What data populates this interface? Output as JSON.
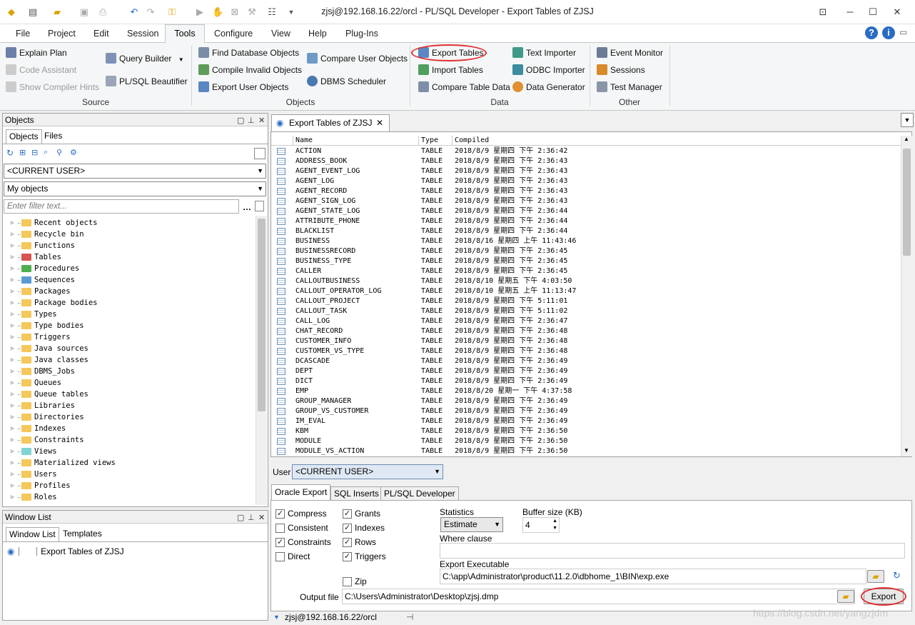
{
  "window": {
    "title": "zjsj@192.168.16.22/orcl - PL/SQL Developer - Export Tables of ZJSJ",
    "restore": "⊡",
    "minimize": "─",
    "maximize": "☐",
    "close": "✕"
  },
  "menu": [
    "File",
    "Project",
    "Edit",
    "Session",
    "Tools",
    "Configure",
    "View",
    "Help",
    "Plug-Ins"
  ],
  "ribbon": {
    "source": {
      "label": "Source",
      "explain_plan": "Explain Plan",
      "code_assistant": "Code Assistant",
      "show_compiler_hints": "Show Compiler Hints",
      "query_builder": "Query Builder",
      "beautifier": "PL/SQL Beautifier"
    },
    "objects": {
      "label": "Objects",
      "find_db_objects": "Find Database Objects",
      "compile_invalid": "Compile Invalid Objects",
      "export_user": "Export User Objects",
      "compare_user": "Compare User Objects",
      "dbms_scheduler": "DBMS Scheduler"
    },
    "data": {
      "label": "Data",
      "export_tables": "Export Tables",
      "import_tables": "Import Tables",
      "compare_table": "Compare Table Data",
      "text_importer": "Text Importer",
      "odbc_importer": "ODBC Importer",
      "data_generator": "Data Generator"
    },
    "other": {
      "label": "Other",
      "event_monitor": "Event Monitor",
      "sessions": "Sessions",
      "test_manager": "Test Manager"
    }
  },
  "objects_panel": {
    "title": "Objects",
    "tabs": [
      "Objects",
      "Files"
    ],
    "user_combo": "<CURRENT USER>",
    "filter_combo": "My objects",
    "filter_placeholder": "Enter filter text...",
    "tree": [
      "Recent objects",
      "Recycle bin",
      "Functions",
      "Tables",
      "Procedures",
      "Sequences",
      "Packages",
      "Package bodies",
      "Types",
      "Type bodies",
      "Triggers",
      "Java sources",
      "Java classes",
      "DBMS_Jobs",
      "Queues",
      "Queue tables",
      "Libraries",
      "Directories",
      "Indexes",
      "Constraints",
      "Views",
      "Materialized views",
      "Users",
      "Profiles",
      "Roles"
    ]
  },
  "window_list": {
    "title": "Window List",
    "tabs": [
      "Window List",
      "Templates"
    ],
    "item": "Export Tables of ZJSJ"
  },
  "main_tab": {
    "label": "Export Tables of ZJSJ"
  },
  "grid": {
    "headers": [
      "Name",
      "Type",
      "Compiled"
    ],
    "rows": [
      [
        "ACTION",
        "TABLE",
        "2018/8/9 星期四 下午 2:36:42"
      ],
      [
        "ADDRESS_BOOK",
        "TABLE",
        "2018/8/9 星期四 下午 2:36:43"
      ],
      [
        "AGENT_EVENT_LOG",
        "TABLE",
        "2018/8/9 星期四 下午 2:36:43"
      ],
      [
        "AGENT_LOG",
        "TABLE",
        "2018/8/9 星期四 下午 2:36:43"
      ],
      [
        "AGENT_RECORD",
        "TABLE",
        "2018/8/9 星期四 下午 2:36:43"
      ],
      [
        "AGENT_SIGN_LOG",
        "TABLE",
        "2018/8/9 星期四 下午 2:36:43"
      ],
      [
        "AGENT_STATE_LOG",
        "TABLE",
        "2018/8/9 星期四 下午 2:36:44"
      ],
      [
        "ATTRIBUTE_PHONE",
        "TABLE",
        "2018/8/9 星期四 下午 2:36:44"
      ],
      [
        "BLACKLIST",
        "TABLE",
        "2018/8/9 星期四 下午 2:36:44"
      ],
      [
        "BUSINESS",
        "TABLE",
        "2018/8/16 星期四 上午 11:43:46"
      ],
      [
        "BUSINESSRECORD",
        "TABLE",
        "2018/8/9 星期四 下午 2:36:45"
      ],
      [
        "BUSINESS_TYPE",
        "TABLE",
        "2018/8/9 星期四 下午 2:36:45"
      ],
      [
        "CALLER",
        "TABLE",
        "2018/8/9 星期四 下午 2:36:45"
      ],
      [
        "CALLOUTBUSINESS",
        "TABLE",
        "2018/8/10 星期五 下午 4:03:50"
      ],
      [
        "CALLOUT_OPERATOR_LOG",
        "TABLE",
        "2018/8/10 星期五 上午 11:13:47"
      ],
      [
        "CALLOUT_PROJECT",
        "TABLE",
        "2018/8/9 星期四 下午 5:11:01"
      ],
      [
        "CALLOUT_TASK",
        "TABLE",
        "2018/8/9 星期四 下午 5:11:02"
      ],
      [
        "CALL_LOG",
        "TABLE",
        "2018/8/9 星期四 下午 2:36:47"
      ],
      [
        "CHAT_RECORD",
        "TABLE",
        "2018/8/9 星期四 下午 2:36:48"
      ],
      [
        "CUSTOMER_INFO",
        "TABLE",
        "2018/8/9 星期四 下午 2:36:48"
      ],
      [
        "CUSTOMER_VS_TYPE",
        "TABLE",
        "2018/8/9 星期四 下午 2:36:48"
      ],
      [
        "DCASCADE",
        "TABLE",
        "2018/8/9 星期四 下午 2:36:49"
      ],
      [
        "DEPT",
        "TABLE",
        "2018/8/9 星期四 下午 2:36:49"
      ],
      [
        "DICT",
        "TABLE",
        "2018/8/9 星期四 下午 2:36:49"
      ],
      [
        "EMP",
        "TABLE",
        "2018/8/20 星期一 下午 4:37:58"
      ],
      [
        "GROUP_MANAGER",
        "TABLE",
        "2018/8/9 星期四 下午 2:36:49"
      ],
      [
        "GROUP_VS_CUSTOMER",
        "TABLE",
        "2018/8/9 星期四 下午 2:36:49"
      ],
      [
        "IM_EVAL",
        "TABLE",
        "2018/8/9 星期四 下午 2:36:49"
      ],
      [
        "KBM",
        "TABLE",
        "2018/8/9 星期四 下午 2:36:50"
      ],
      [
        "MODULE",
        "TABLE",
        "2018/8/9 星期四 下午 2:36:50"
      ],
      [
        "MODULE_VS_ACTION",
        "TABLE",
        "2018/8/9 星期四 下午 2:36:50"
      ]
    ]
  },
  "export": {
    "user_label": "User",
    "user_value": "<CURRENT USER>",
    "tabs": [
      "Oracle Export",
      "SQL Inserts",
      "PL/SQL Developer"
    ],
    "compress": "Compress",
    "consistent": "Consistent",
    "constraints": "Constraints",
    "direct": "Direct",
    "grants": "Grants",
    "indexes": "Indexes",
    "rows": "Rows",
    "triggers": "Triggers",
    "zip": "Zip",
    "checked_mark": "✓",
    "statistics_label": "Statistics",
    "statistics_value": "Estimate",
    "buffer_label": "Buffer size (KB)",
    "buffer_value": "4",
    "where_label": "Where clause",
    "executable_label": "Export Executable",
    "executable_value": "C:\\app\\Administrator\\product\\11.2.0\\dbhome_1\\BIN\\exp.exe",
    "output_label": "Output file",
    "output_value": "C:\\Users\\Administrator\\Desktop\\zjsj.dmp",
    "export_button": "Export"
  },
  "status": {
    "connection": "zjsj@192.168.16.22/orcl",
    "watermark": "https://blog.csdn.net/yangzjdm"
  },
  "colors": {
    "accent": "#2a6cc4",
    "highlight": "#e03030"
  }
}
